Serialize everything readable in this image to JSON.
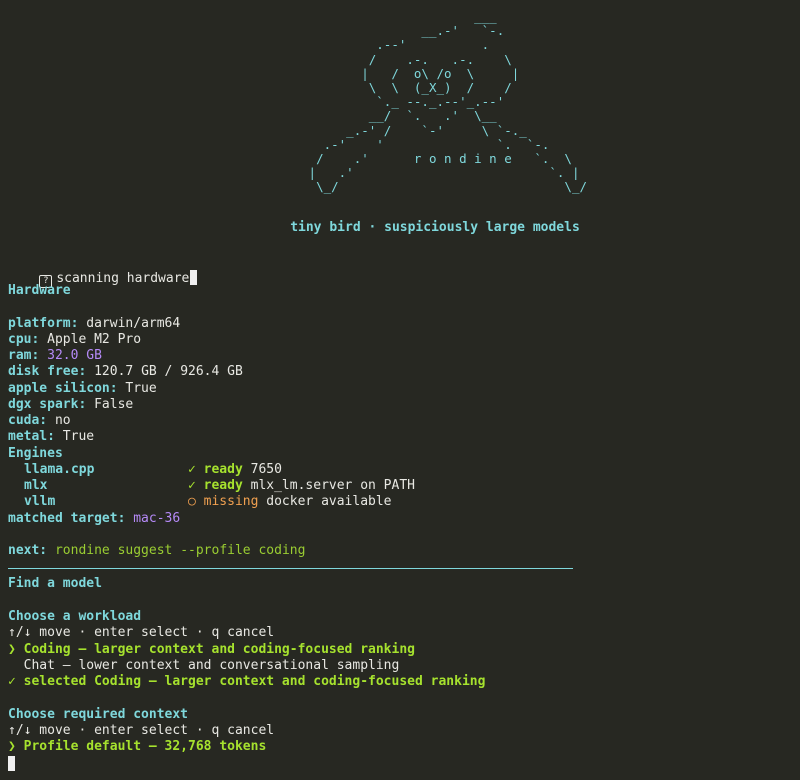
{
  "ascii_art": "                                                               ___\n                                                        __.-'   `-.\n                                                  .--'          .\n                                                 /    .-.   .-.    \\\n                                                |   /  o\\ /o  \\     |\n                                                 \\  \\  (_X_)  /    /\n                                                  `._ --._.--'_.--'\n                                                 __/  `.   .'  \\__\n                                              _.-' /    `-'     \\ `-._\n                                           .-'    '               `.  `-.\n                                          /    .'      r o n d i n e   `.  \\\n                                         |   .'                          `. |\n                                          \\_/                              \\_/",
  "tagline": "tiny bird · suspiciously large models",
  "status": {
    "text": "scanning hardware"
  },
  "hardware": {
    "title": "Hardware",
    "platform": {
      "label": "platform:",
      "value": "darwin/arm64"
    },
    "cpu": {
      "label": "cpu:",
      "value": "Apple M2 Pro"
    },
    "ram": {
      "label": "ram:",
      "value": "32.0 GB"
    },
    "disk": {
      "label": "disk free:",
      "value": "120.7 GB / 926.4 GB"
    },
    "apple_silicon": {
      "label": "apple silicon:",
      "value": "True"
    },
    "dgx": {
      "label": "dgx spark:",
      "value": "False"
    },
    "cuda": {
      "label": "cuda:",
      "value": "no"
    },
    "metal": {
      "label": "metal:",
      "value": "True"
    }
  },
  "engines": {
    "title": "Engines",
    "items": [
      {
        "name": "llama.cpp",
        "status": "✓ ready",
        "detail": "7650"
      },
      {
        "name": "mlx",
        "status": "✓ ready",
        "detail": "mlx_lm.server on PATH"
      },
      {
        "name": "vllm",
        "status": "○ missing",
        "detail": "docker available"
      }
    ]
  },
  "matched": {
    "label": "matched target:",
    "value": "mac-36"
  },
  "next": {
    "label": "next:",
    "command": "rondine suggest --profile coding"
  },
  "find_model": {
    "title": "Find a model"
  },
  "workload": {
    "title": "Choose a workload",
    "hint": "↑/↓ move · enter select · q cancel",
    "options": [
      {
        "text": "❯ Coding — larger context and coding-focused ranking"
      },
      {
        "text": "  Chat — lower context and conversational sampling"
      }
    ],
    "selected": "✓ selected Coding — larger context and coding-focused ranking"
  },
  "context": {
    "title": "Choose required context",
    "hint": "↑/↓ move · enter select · q cancel",
    "option": "❯ Profile default — 32,768 tokens"
  },
  "colors": {
    "background": "#272822",
    "cyan": "#7fd8dc",
    "green": "#a6e22e",
    "purple": "#b58af7",
    "orange": "#f0a050"
  }
}
